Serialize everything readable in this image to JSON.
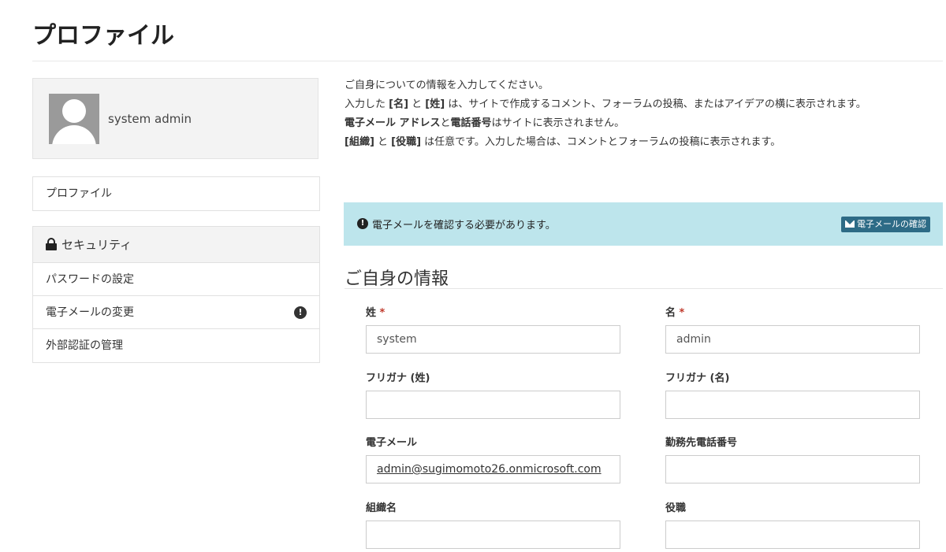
{
  "page": {
    "title": "プロファイル"
  },
  "sidebar": {
    "user_name": "system admin",
    "profile_link": "プロファイル",
    "security": {
      "heading": "セキュリティ",
      "items": [
        {
          "label": "パスワードの設定"
        },
        {
          "label": "電子メールの変更",
          "badge": "!"
        },
        {
          "label": "外部認証の管理"
        }
      ]
    }
  },
  "intro": {
    "line1": "ご自身についての情報を入力してください。",
    "line2_parts": [
      "入力した ",
      "[名]",
      " と ",
      "[姓]",
      " は、サイトで作成するコメント、フォーラムの投稿、またはアイデアの横に表示されます。"
    ],
    "line3_parts": [
      "電子メール アドレス",
      "と",
      "電話番号",
      "はサイトに表示されません。"
    ],
    "line4_parts": [
      "[組織]",
      " と ",
      "[役職]",
      " は任意です。入力した場合は、コメントとフォーラムの投稿に表示されます。"
    ]
  },
  "alert": {
    "icon": "!",
    "message": "電子メールを確認する必要があります。",
    "button_label": "電子メールの確認"
  },
  "section": {
    "title": "ご自身の情報"
  },
  "form": {
    "last_name": {
      "label": "姓",
      "required_mark": "*",
      "value": "system"
    },
    "first_name": {
      "label": "名",
      "required_mark": "*",
      "value": "admin"
    },
    "last_name_kana": {
      "label": "フリガナ (姓)",
      "value": ""
    },
    "first_name_kana": {
      "label": "フリガナ (名)",
      "value": ""
    },
    "email": {
      "label": "電子メール",
      "value": "admin@sugimomoto26.onmicrosoft.com"
    },
    "work_phone": {
      "label": "勤務先電話番号",
      "value": ""
    },
    "organization": {
      "label": "組織名",
      "value": ""
    },
    "job_title": {
      "label": "役職",
      "value": ""
    }
  },
  "colors": {
    "alert_bg": "#bde5ec",
    "button_bg": "#2d6b86",
    "required": "#c0392b"
  }
}
